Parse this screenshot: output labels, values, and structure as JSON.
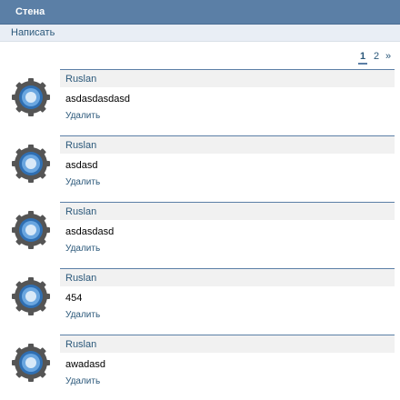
{
  "header": {
    "title": "Стена"
  },
  "actions": {
    "write_label": "Написать"
  },
  "pager": {
    "current": "1",
    "page2": "2",
    "next": "»"
  },
  "posts": [
    {
      "author": "Ruslan",
      "text": "asdasdasdasd",
      "delete_label": "Удалить"
    },
    {
      "author": "Ruslan",
      "text": "asdasd",
      "delete_label": "Удалить"
    },
    {
      "author": "Ruslan",
      "text": "asdasdasd",
      "delete_label": "Удалить"
    },
    {
      "author": "Ruslan",
      "text": "454",
      "delete_label": "Удалить"
    },
    {
      "author": "Ruslan",
      "text": "awadasd",
      "delete_label": "Удалить"
    }
  ],
  "colors": {
    "header_bg": "#5b7fa6",
    "link": "#2b587a",
    "action_bar_bg": "#e9eef5"
  },
  "icons": {
    "avatar": "gear-icon"
  }
}
